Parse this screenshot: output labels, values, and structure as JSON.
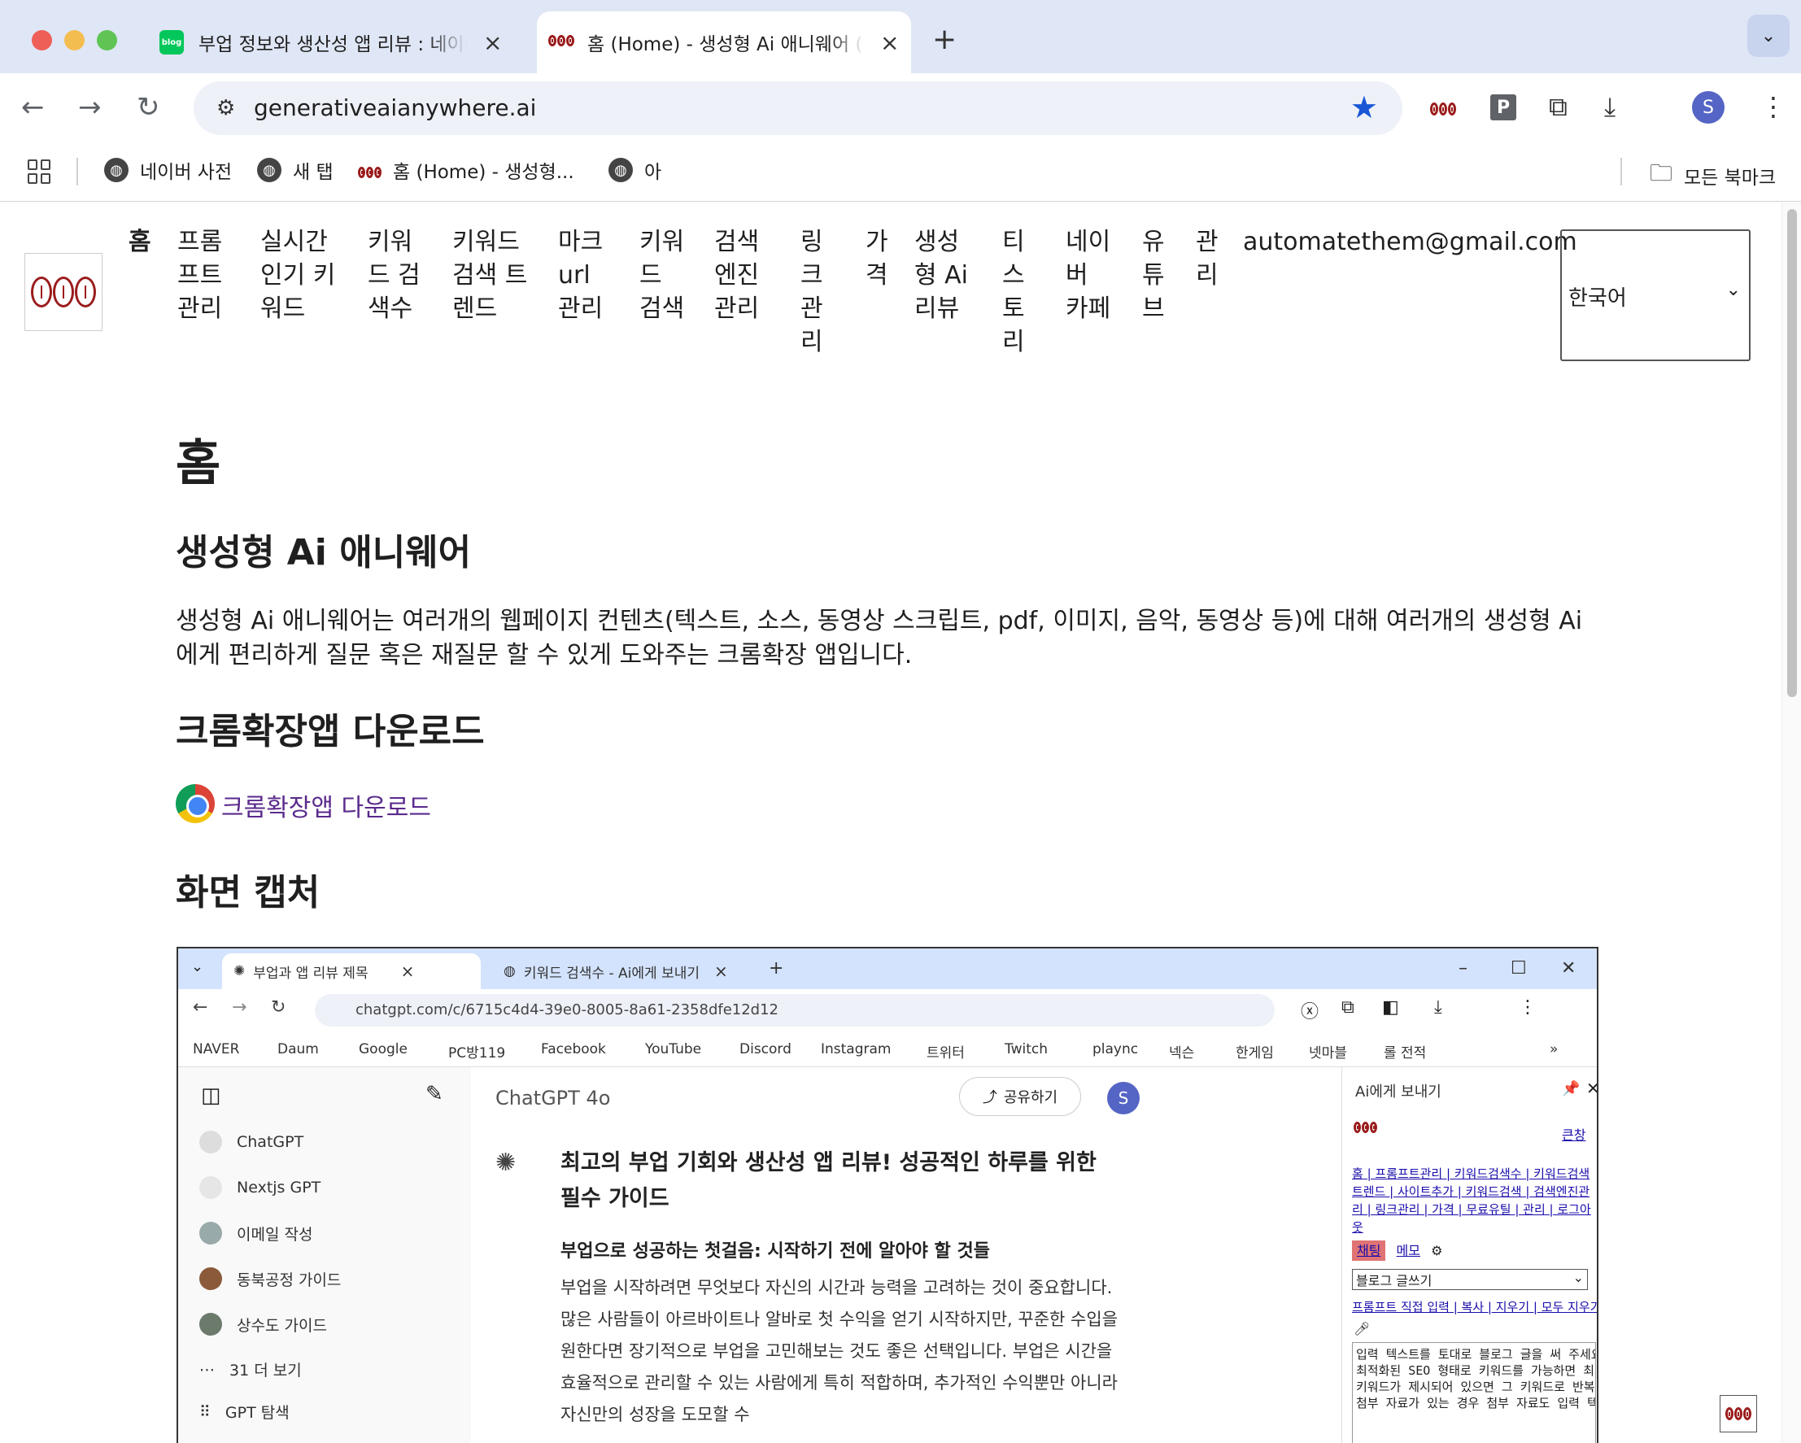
{
  "browser": {
    "tabs": [
      {
        "title": "부업 정보와 생산성 앱 리뷰 : 네이버",
        "favicon": "blog",
        "active": false
      },
      {
        "title": "홈 (Home) - 생성형 Ai 애니웨어 (",
        "favicon": "logo",
        "active": true
      }
    ],
    "url": "generativeaianywhere.ai",
    "avatar_letter": "S",
    "bookmarks": [
      {
        "label": "네이버 사전"
      },
      {
        "label": "새 탭"
      },
      {
        "label": "홈 (Home) - 생성형..."
      },
      {
        "label": "아"
      }
    ],
    "all_bookmarks_label": "모든 북마크",
    "p_extension": "P"
  },
  "site": {
    "nav": [
      {
        "label": "홈"
      },
      {
        "label": "프롬\n프트\n관리"
      },
      {
        "label": "실시간\n인기 키\n워드"
      },
      {
        "label": "키워\n드 검\n색수"
      },
      {
        "label": "키워드\n검색 트\n렌드"
      },
      {
        "label": "마크\nurl\n관리"
      },
      {
        "label": "키워\n드\n검색"
      },
      {
        "label": "검색\n엔진\n관리"
      },
      {
        "label": "링\n크\n관\n리"
      },
      {
        "label": "가\n격"
      },
      {
        "label": "생성\n형 Ai\n리뷰"
      },
      {
        "label": "티\n스\n토\n리"
      },
      {
        "label": "네이\n버\n카페"
      },
      {
        "label": "유\n튜\n브"
      },
      {
        "label": "관\n리"
      },
      {
        "label": "automatethem@gmail.com"
      }
    ],
    "language": "한국어"
  },
  "content": {
    "h1": "홈",
    "h2_app": "생성형 Ai 애니웨어",
    "intro": "생성형 Ai 애니웨어는 여러개의 웹페이지 컨텐츠(텍스트, 소스, 동영상 스크립트, pdf, 이미지, 음악, 동영상 등)에 대해 여러개의 생성형 Ai에게 편리하게 질문 혹은 재질문 할 수 있게 도와주는 크롬확장 앱입니다.",
    "h2_download": "크롬확장앱 다운로드",
    "download_link": "크롬확장앱 다운로드",
    "h2_capture": "화면 캡처"
  },
  "screenshot": {
    "tabs": [
      "부업과 앱 리뷰 제목",
      "키워드 검색수 - Ai에게 보내기"
    ],
    "url": "chatgpt.com/c/6715c4d4-39e0-8005-8a61-2358dfe12d12",
    "bookmarks": [
      "NAVER",
      "Daum",
      "Google",
      "PC방119",
      "Facebook",
      "YouTube",
      "Discord",
      "Instagram",
      "트위터",
      "Twitch",
      "plaync",
      "넥슨",
      "한게임",
      "넷마블",
      "롤 전적"
    ],
    "sidebar": [
      "ChatGPT",
      "Nextjs GPT",
      "이메일 작성",
      "동북공정 가이드",
      "상수도 가이드",
      "31 더 보기"
    ],
    "sidebar_partial": "GPT 탐색",
    "model": "ChatGPT 4o",
    "share": "공유하기",
    "avatar": "S",
    "title": "최고의 부업 기회와 생산성 앱 리뷰! 성공적인 하루를 위한 필수 가이드",
    "subtitle": "부업으로 성공하는 첫걸음: 시작하기 전에 알아야 할 것들",
    "body": "부업을 시작하려면 무엇보다 자신의 시간과 능력을 고려하는 것이 중요합니다. 많은 사람들이 아르바이트나 알바로 첫 수익을 얻기 시작하지만, 꾸준한 수입을 원한다면 장기적으로 부업을 고민해보는 것도 좋은 선택입니다. 부업은 시간을 효율적으로 관리할 수 있는 사람에게 특히 적합하며, 추가적인 수익뿐만 아니라 자신만의 성장을 도모할 수",
    "panel": {
      "title": "Ai에게 보내기",
      "bigwin": "큰창",
      "links": "홈 | 프롬프트관리 | 키워드검색수 | 키워드검색트렌드 | 사이트추가 | 키워드검색 | 검색엔진관리 | 링크관리 | 가격 | 무료유틸 | 관리 | 로그아웃",
      "chat": "채팅",
      "memo": "메모",
      "select": "블로그 글쓰기",
      "actions": "프롬프트 직접 입력 | 복사 | 지우기 | 모두 지우기 | 붙여 넣기 |",
      "textarea": "입력 텍스트를 토대로 블로그 글을 써 주세요.\n최적화된 SEO 형태로 키워드를 가능하면 최대 5~6번\n키워드가 제시되어 있으면 그 키워드로 반복해 주세요\n첨부 자료가 있는 경우 첨부 자료도 입력 텍스트에 포"
    }
  }
}
